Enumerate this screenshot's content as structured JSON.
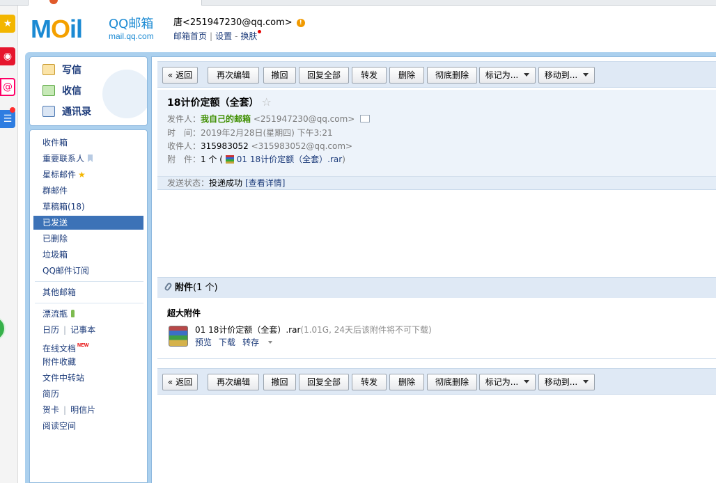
{
  "header": {
    "logo_word_a": "M",
    "logo_word_o": "O",
    "logo_word_b": "il",
    "logo_title": "QQ邮箱",
    "logo_url": "mail.qq.com",
    "user": "唐<251947230@qq.com>",
    "warn_mark": "!",
    "links": [
      "邮箱首页",
      "设置",
      "换肤"
    ],
    "link_separators": [
      "|",
      "-"
    ]
  },
  "dock": {
    "icons": [
      "star-icon",
      "weibo-icon",
      "mail-at-icon",
      "app-list-icon",
      "green-app-icon"
    ],
    "glyphs": {
      "star": "★",
      "weibo": "◉",
      "at": "@",
      "list": "☰"
    }
  },
  "sidebar": {
    "top_items": [
      {
        "label": "写信",
        "icon": "pencil-icon"
      },
      {
        "label": "收信",
        "icon": "inbox-download-icon"
      },
      {
        "label": "通讯录",
        "icon": "contacts-card-icon"
      }
    ],
    "folders": [
      {
        "label": "收件箱"
      },
      {
        "label": "重要联系人"
      },
      {
        "label": "星标邮件"
      },
      {
        "label": "群邮件"
      },
      {
        "label": "草稿箱(18)"
      },
      {
        "label": "已发送",
        "active": true
      },
      {
        "label": "已删除"
      },
      {
        "label": "垃圾箱"
      },
      {
        "label": "QQ邮件订阅"
      }
    ],
    "other_mailbox": "其他邮箱",
    "tools": {
      "drift_bottle": "漂流瓶",
      "calendar": "日历",
      "notebook": "记事本",
      "online_docs": "在线文档",
      "new_badge": "NEW",
      "attachment_fav": "附件收藏",
      "transfer_station": "文件中转站",
      "resume": "简历",
      "greeting_card": "贺卡",
      "postcard": "明信片",
      "reading_space": "阅读空间",
      "separator": "|"
    }
  },
  "toolbar": {
    "back": "« 返回",
    "edit_again": "再次编辑",
    "recall": "撤回",
    "reply_all": "回复全部",
    "forward": "转发",
    "delete": "删除",
    "delete_forever": "彻底删除",
    "mark_as": "标记为...",
    "move_to": "移动到..."
  },
  "mail": {
    "subject": "18计价定额（全套）",
    "star_glyph": "☆",
    "from_label": "发件人：",
    "from_name": "我自己的邮箱",
    "from_addr": "<251947230@qq.com>",
    "time_label": "时　间：",
    "time_value": "2019年2月28日(星期四) 下午3:21",
    "to_label": "收件人：",
    "to_name": "315983052",
    "to_addr": "<315983052@qq.com>",
    "att_label": "附　件：",
    "att_count": "1 个 (",
    "att_file": "01 18计价定额（全套）.rar",
    "att_close": ")",
    "status_label": "发送状态：",
    "status_value": "投递成功",
    "status_link": "[查看详情]"
  },
  "attachments": {
    "title": "附件",
    "count": "(1 个)",
    "section": "超大附件",
    "file_name": "01 18计价定额（全套）.rar",
    "file_meta": "(1.01G, 24天后该附件将不可下载)",
    "actions": [
      "预览",
      "下载",
      "转存"
    ]
  }
}
